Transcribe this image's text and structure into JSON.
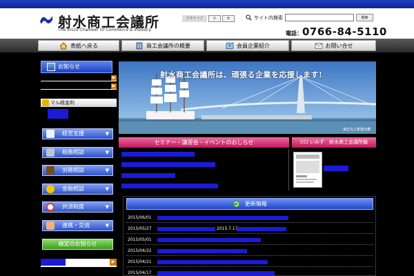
{
  "colors": {
    "link_blue": "#1b1bd8",
    "accent_pink": "#c2185b",
    "nav_dark": "#2b2b2b",
    "side_blue": "#2f54c8",
    "kentei_green": "#3d9a1b"
  },
  "header": {
    "logo_title": "射水商工会議所",
    "logo_sub": "The Imizu Chamber Of Commerce & Industry",
    "fontsize_label": "文字サイズ",
    "fontsize_small": "小",
    "fontsize_large": "大",
    "search_label": "サイト内検索",
    "search_value": "",
    "search_button": "検索",
    "phone_label": "電話：",
    "phone_number": "0766-84-5110"
  },
  "nav": {
    "items": [
      {
        "label": "表紙へ戻る",
        "icon": "home-icon"
      },
      {
        "label": "商工会議所の概要",
        "icon": "building-icon"
      },
      {
        "label": "会員企業紹介",
        "icon": "map-icon"
      },
      {
        "label": "お問い合せ",
        "icon": "mail-icon"
      }
    ]
  },
  "sidebar": {
    "notice_title": "お知らせ",
    "kinri_title": "マル経金利",
    "buttons": [
      {
        "label": "経営支援",
        "icon": "document-icon"
      },
      {
        "label": "税務相談",
        "icon": "calculator-icon"
      },
      {
        "label": "労務相談",
        "icon": "briefcase-icon"
      },
      {
        "label": "金融相談",
        "icon": "coin-icon"
      },
      {
        "label": "共済制度",
        "icon": "lifebuoy-icon"
      },
      {
        "label": "連携・交流",
        "icon": "handshake-icon"
      }
    ],
    "kentei_label": "検定のお知らせ",
    "arrow": "▼"
  },
  "banner": {
    "headline": "射水商工会議所は、頑張る企業を応援します!",
    "caption": "海王丸と新湊大橋"
  },
  "seminar": {
    "title": "セミナー・講習会・イベントのおしらせ"
  },
  "cci": {
    "title": "CCI いみず　射水商工会議所報"
  },
  "news": {
    "title": "更新情報",
    "rows": [
      {
        "date": "2015/06/01",
        "suffix": ""
      },
      {
        "date": "2015/05/27",
        "suffix": "2015.7.17"
      },
      {
        "date": "2015/05/01",
        "suffix": ""
      },
      {
        "date": "2015/04/22",
        "suffix": ""
      },
      {
        "date": "2015/04/21",
        "suffix": ""
      },
      {
        "date": "2015/04/17",
        "suffix": ""
      }
    ]
  }
}
